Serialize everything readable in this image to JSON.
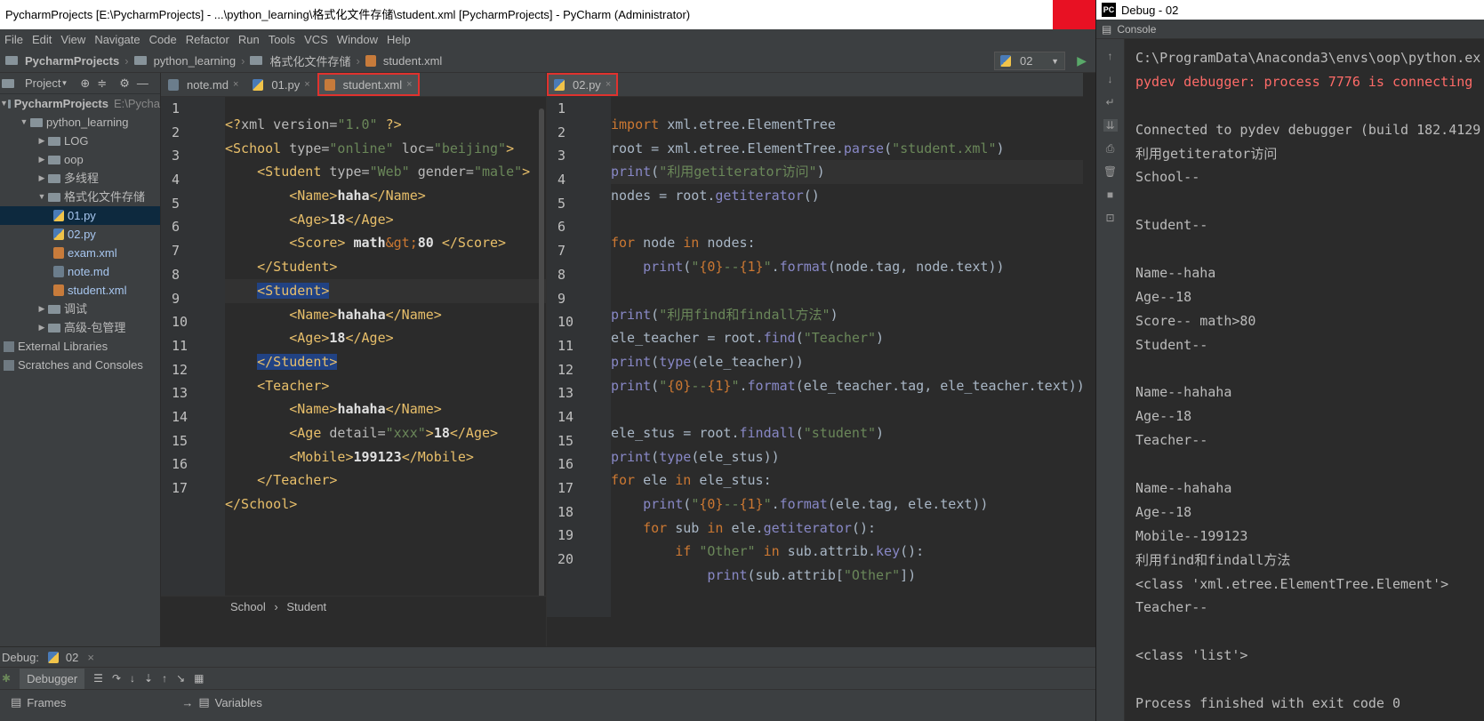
{
  "window": {
    "title": "PycharmProjects [E:\\PycharmProjects] - ...\\python_learning\\格式化文件存储\\student.xml [PycharmProjects] - PyCharm (Administrator)"
  },
  "menu": [
    "File",
    "Edit",
    "View",
    "Navigate",
    "Code",
    "Refactor",
    "Run",
    "Tools",
    "VCS",
    "Window",
    "Help"
  ],
  "navbar": {
    "crumbs": [
      "PycharmProjects",
      "python_learning",
      "格式化文件存储",
      "student.xml"
    ],
    "run_config": "02"
  },
  "project": {
    "header": "Project",
    "root": "PycharmProjects",
    "root_path": "E:\\Pycha",
    "items": [
      {
        "label": "python_learning",
        "type": "folder",
        "indent": 1,
        "open": true
      },
      {
        "label": "LOG",
        "type": "folder",
        "indent": 2,
        "open": false
      },
      {
        "label": "oop",
        "type": "folder",
        "indent": 2,
        "open": false
      },
      {
        "label": "多线程",
        "type": "folder",
        "indent": 2,
        "open": false
      },
      {
        "label": "格式化文件存储",
        "type": "folder",
        "indent": 2,
        "open": true
      },
      {
        "label": "01.py",
        "type": "py",
        "indent": 3
      },
      {
        "label": "02.py",
        "type": "py",
        "indent": 3
      },
      {
        "label": "exam.xml",
        "type": "xml",
        "indent": 3
      },
      {
        "label": "note.md",
        "type": "md",
        "indent": 3
      },
      {
        "label": "student.xml",
        "type": "xml",
        "indent": 3
      },
      {
        "label": "调试",
        "type": "folder",
        "indent": 2,
        "open": false
      },
      {
        "label": "高级-包管理",
        "type": "folder",
        "indent": 2,
        "open": false
      },
      {
        "label": "External Libraries",
        "type": "lib",
        "indent": 0
      },
      {
        "label": "Scratches and Consoles",
        "type": "lib",
        "indent": 0
      }
    ]
  },
  "editor_left": {
    "tabs": [
      "note.md",
      "01.py",
      "student.xml"
    ],
    "breadcrumb": [
      "School",
      "Student"
    ]
  },
  "editor_right": {
    "tabs": [
      "02.py"
    ]
  },
  "debug": {
    "label": "Debug:",
    "config": "02",
    "tab": "Debugger",
    "frames": "Frames",
    "variables": "Variables"
  },
  "console": {
    "title": "Debug - 02",
    "tab": "Console",
    "lines": [
      "C:\\ProgramData\\Anaconda3\\envs\\oop\\python.ex",
      "pydev debugger: process 7776 is connecting",
      "",
      "Connected to pydev debugger (build 182.4129",
      "利用getiterator访问",
      "School--",
      "",
      "Student--",
      "",
      "Name--haha",
      "Age--18",
      "Score-- math>80",
      "Student--",
      "",
      "Name--hahaha",
      "Age--18",
      "Teacher--",
      "",
      "Name--hahaha",
      "Age--18",
      "Mobile--199123",
      "利用find和findall方法",
      "<class 'xml.etree.ElementTree.Element'>",
      "Teacher--",
      "",
      "<class 'list'>",
      "",
      "Process finished with exit code 0"
    ]
  },
  "colors": {
    "bg": "#2b2b2b",
    "panel": "#3c3f41",
    "highlight_box": "#e0322e",
    "keyword": "#cc7832",
    "string": "#6a8759",
    "xml_tag": "#e8bf6a"
  }
}
